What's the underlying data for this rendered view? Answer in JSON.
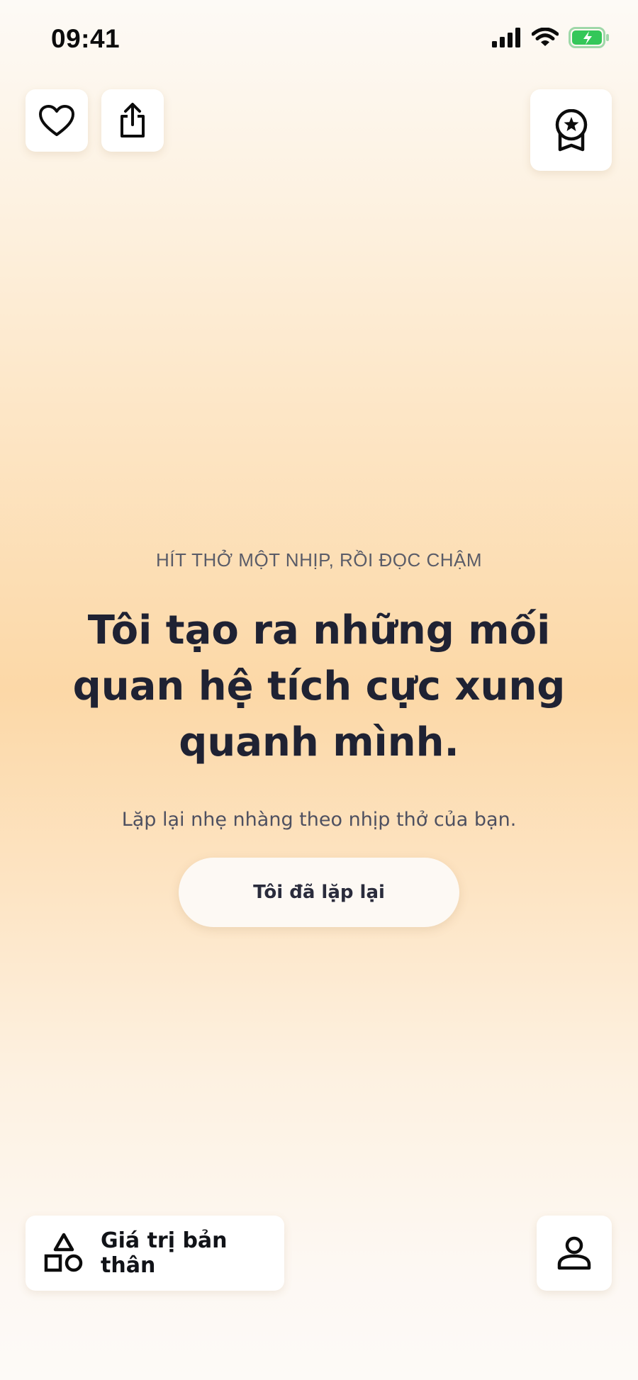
{
  "status_bar": {
    "time": "09:41"
  },
  "top_actions": {
    "like_icon": "heart-icon",
    "share_icon": "share-icon",
    "award_icon": "award-badge-icon"
  },
  "content": {
    "kicker": "HÍT THỞ MỘT NHỊP, RỒI ĐỌC CHẬM",
    "affirmation": "Tôi tạo ra những mối quan hệ tích cực xung quanh mình.",
    "hint": "Lặp lại nhẹ nhàng theo nhịp thở của bạn.",
    "repeat_button": "Tôi đã lặp lại"
  },
  "bottom_bar": {
    "category_label": "Giá trị bản thân",
    "category_icon": "shapes-icon",
    "profile_icon": "person-icon"
  },
  "colors": {
    "background_peak": "#fcd8a7",
    "text_primary": "#1f2233",
    "battery_green": "#34c759"
  }
}
